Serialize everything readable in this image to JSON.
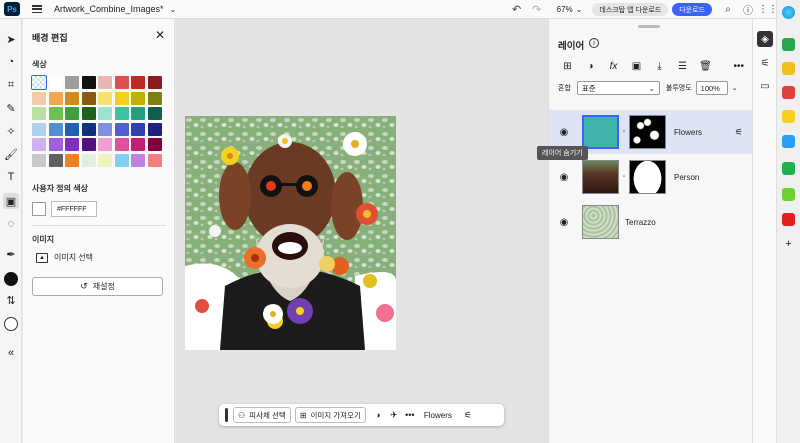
{
  "app": {
    "logo": "Ps",
    "file_name": "Artwork_Combine_Images*",
    "zoom": "67%",
    "desktop_button": "데스크탑 앱 다운로드",
    "download_button": "다운로드"
  },
  "bg_panel": {
    "title": "배경 편집",
    "color_label": "색상",
    "custom_color_label": "사용자 정의 색상",
    "hex_value": "#FFFFFF",
    "image_label": "이미지",
    "select_image": "이미지 선택",
    "reset": "재설정",
    "swatches": [
      "transparent",
      "#ffffff",
      "#9e9e9e",
      "#111111",
      "#e8b4b4",
      "#e05050",
      "#c02828",
      "#8c1c1c",
      "#f5cba7",
      "#f0a850",
      "#d08a20",
      "#8a5a10",
      "#f5e070",
      "#f5d020",
      "#c0b000",
      "#808010",
      "#b8e0a0",
      "#70c050",
      "#40a040",
      "#206020",
      "#a0e0d0",
      "#40c0a0",
      "#20a080",
      "#106050",
      "#b0d0f0",
      "#5090d0",
      "#2060b0",
      "#103080",
      "#8090e0",
      "#5060d0",
      "#3040b0",
      "#202080",
      "#d0b0f0",
      "#a060e0",
      "#8030c0",
      "#501080",
      "#f0a0d0",
      "#e050a0",
      "#c02070",
      "#800040",
      "#c8c8c8",
      "#606060",
      "#f08020",
      "#e0f0e0",
      "#f0f0c0",
      "#80d0f0",
      "#c080e0",
      "#f08080"
    ]
  },
  "context_bar": {
    "select_subject": "피사체 선택",
    "import_image": "이미지 가져오기",
    "layer_name": "Flowers"
  },
  "layers_panel": {
    "title": "레이어",
    "blend_label": "혼합",
    "blend_mode": "표준",
    "opacity_label": "불투명도",
    "opacity_value": "100%",
    "tooltip": "레이어 숨기기",
    "layers": [
      {
        "name": "Flowers"
      },
      {
        "name": "Person"
      },
      {
        "name": "Terrazzo"
      }
    ]
  }
}
